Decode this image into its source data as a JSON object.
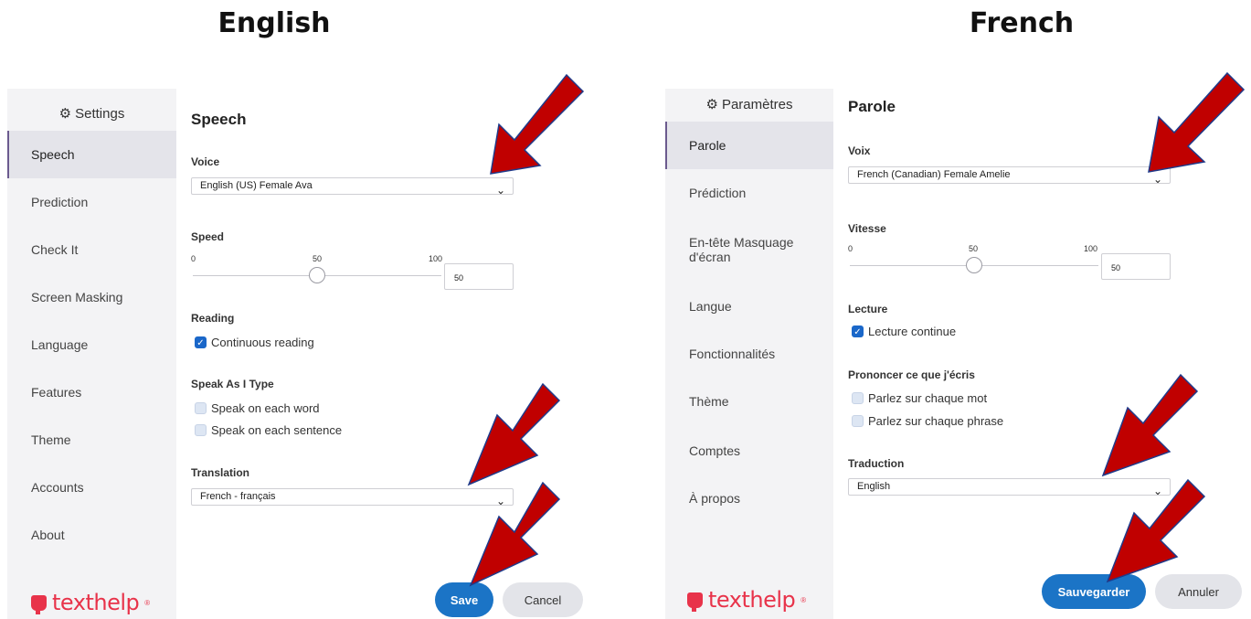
{
  "headings": {
    "english": "English",
    "french": "French"
  },
  "english": {
    "sidebar": {
      "title": "Settings",
      "items": [
        {
          "label": "Speech",
          "active": true
        },
        {
          "label": "Prediction"
        },
        {
          "label": "Check It"
        },
        {
          "label": "Screen Masking"
        },
        {
          "label": "Language"
        },
        {
          "label": "Features"
        },
        {
          "label": "Theme"
        },
        {
          "label": "Accounts"
        },
        {
          "label": "About"
        }
      ],
      "logo": "texthelp"
    },
    "content": {
      "title": "Speech",
      "voice_label": "Voice",
      "voice_value": "English (US) Female Ava",
      "speed_label": "Speed",
      "speed_ticks": [
        "0",
        "50",
        "100"
      ],
      "speed_value": "50",
      "speed_level": 50,
      "reading_label": "Reading",
      "continuous_reading": "Continuous reading",
      "speak_label": "Speak As I Type",
      "speak_word": "Speak on each word",
      "speak_sentence": "Speak on each sentence",
      "translation_label": "Translation",
      "translation_value": "French - français"
    },
    "buttons": {
      "save": "Save",
      "cancel": "Cancel"
    }
  },
  "french": {
    "sidebar": {
      "title": "Paramètres",
      "items": [
        {
          "label": "Parole",
          "active": true
        },
        {
          "label": "Prédiction"
        },
        {
          "label": "En-tête Masquage d'écran"
        },
        {
          "label": "Langue"
        },
        {
          "label": "Fonctionnalités"
        },
        {
          "label": "Thème"
        },
        {
          "label": "Comptes"
        },
        {
          "label": "À propos"
        }
      ],
      "logo": "texthelp"
    },
    "content": {
      "title": "Parole",
      "voice_label": "Voix",
      "voice_value": "French (Canadian) Female Amelie",
      "speed_label": "Vitesse",
      "speed_ticks": [
        "0",
        "50",
        "100"
      ],
      "speed_value": "50",
      "speed_level": 50,
      "reading_label": "Lecture",
      "continuous_reading": "Lecture continue",
      "speak_label": "Prononcer ce que j'écris",
      "speak_word": "Parlez sur chaque mot",
      "speak_sentence": "Parlez sur chaque phrase",
      "translation_label": "Traduction",
      "translation_value": "English"
    },
    "buttons": {
      "save": "Sauvegarder",
      "cancel": "Annuler"
    }
  },
  "colors": {
    "accent": "#1b74c6",
    "arrow_fill": "#c00000",
    "arrow_stroke": "#1f3a8a",
    "logo": "#e8334a"
  }
}
